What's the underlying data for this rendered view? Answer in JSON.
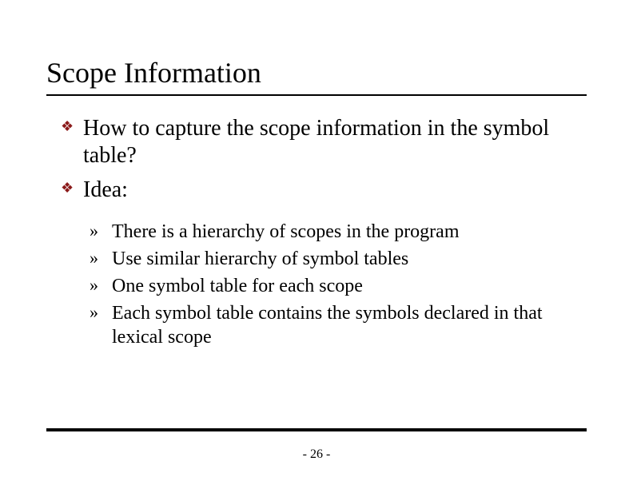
{
  "title": "Scope Information",
  "bullets": [
    {
      "text": "How to capture the scope information in the symbol table?"
    },
    {
      "text": "Idea:"
    }
  ],
  "subbullets": [
    {
      "text": "There is a hierarchy of scopes in the program"
    },
    {
      "text": "Use similar hierarchy of symbol tables"
    },
    {
      "text": "One symbol table for each scope"
    },
    {
      "text": "Each symbol table contains the symbols declared in that lexical scope"
    }
  ],
  "page_number": "- 26 -",
  "icons": {
    "diamond": "❖",
    "raquo": "»"
  }
}
